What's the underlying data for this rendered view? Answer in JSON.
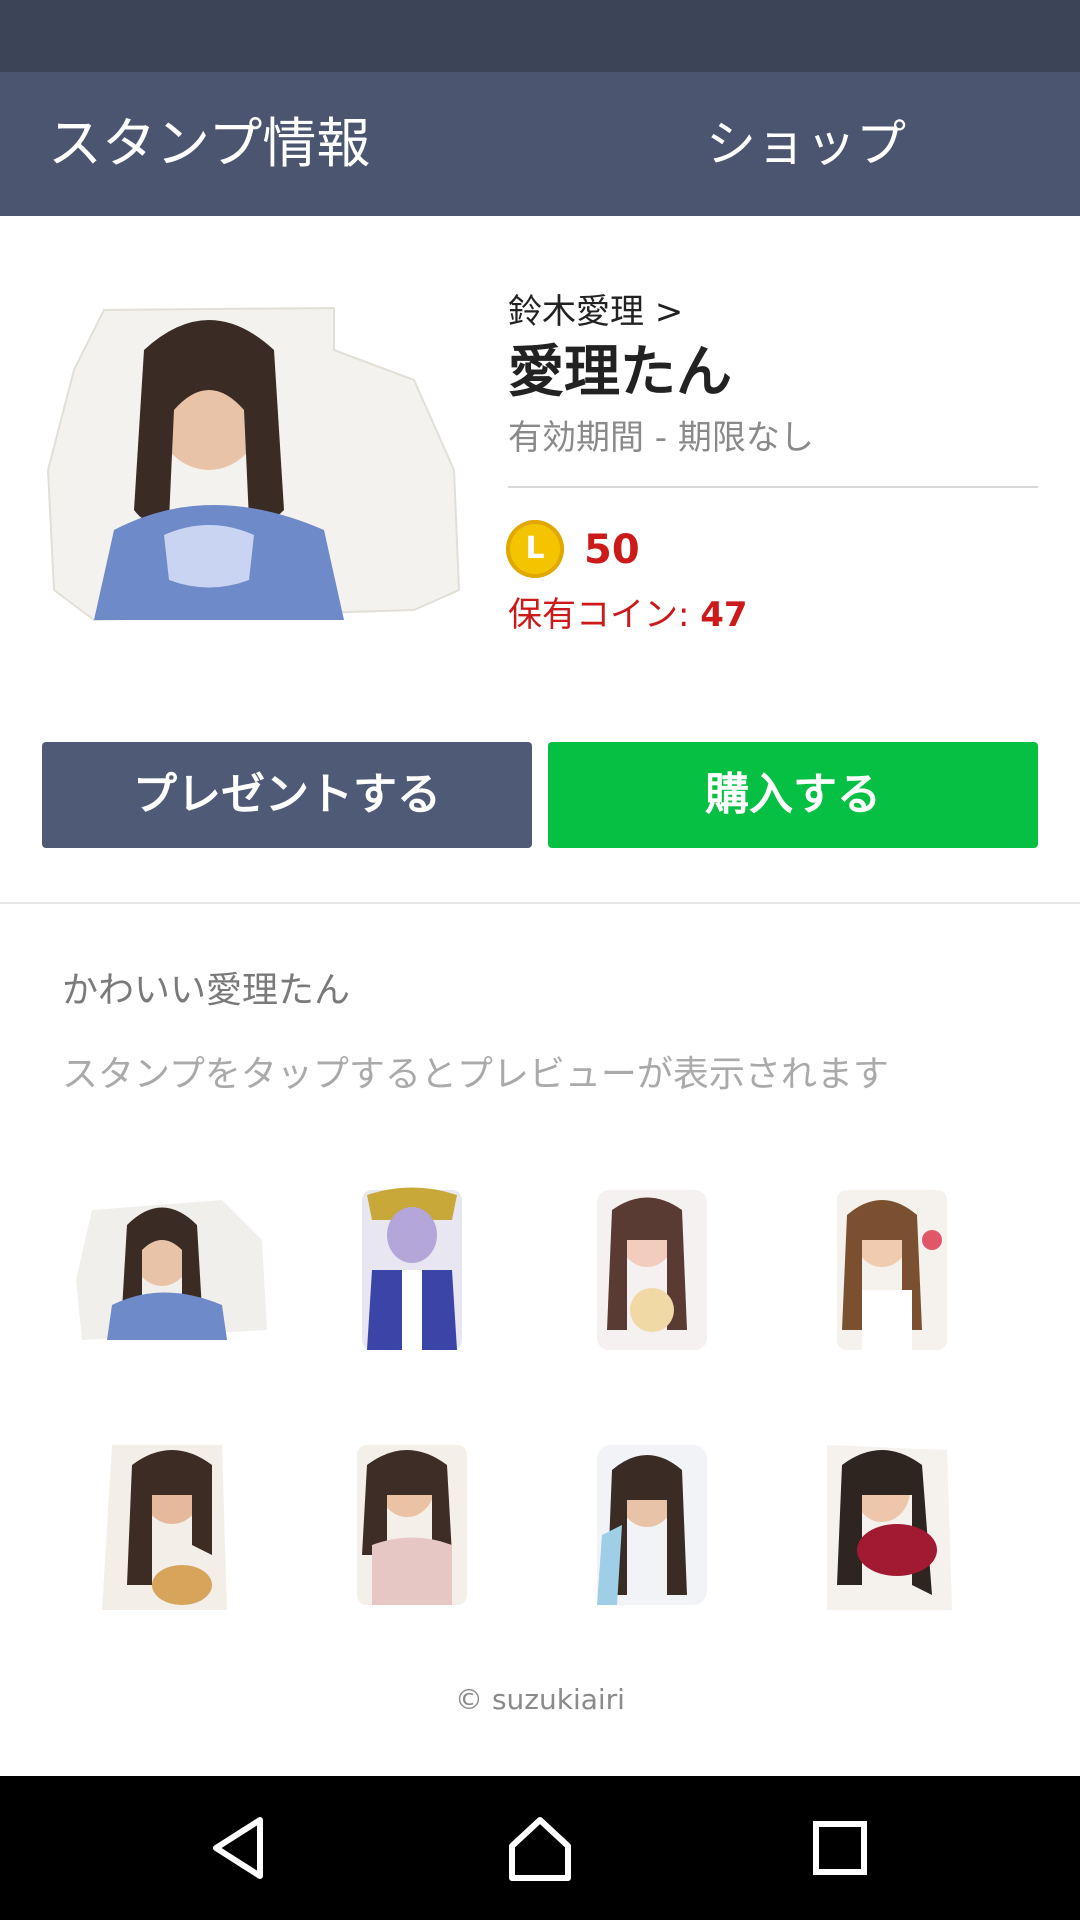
{
  "appbar": {
    "title": "スタンプ情報",
    "shop_label": "ショップ",
    "share_icon": "share-icon"
  },
  "product": {
    "author": "鈴木愛理 >",
    "name": "愛理たん",
    "validity": "有効期間 - 期限なし",
    "coin_letter": "L",
    "price": "50",
    "owned_label": "保有コイン: ",
    "owned_value": "47"
  },
  "buttons": {
    "gift": "プレゼントする",
    "buy": "購入する"
  },
  "colors": {
    "appbar": "#4b5570",
    "buy": "#06c043",
    "gift": "#4f5a76",
    "price": "#cc1a1a"
  },
  "description": "かわいい愛理たん",
  "hint": "スタンプをタップするとプレビューが表示されます",
  "stickers": [
    "sticker-1",
    "sticker-2",
    "sticker-3",
    "sticker-4",
    "sticker-5",
    "sticker-6",
    "sticker-7",
    "sticker-8"
  ],
  "copyright": "© suzukiairi",
  "navbar": {
    "back_icon": "back-icon",
    "home_icon": "home-icon",
    "recents_icon": "recents-icon"
  }
}
